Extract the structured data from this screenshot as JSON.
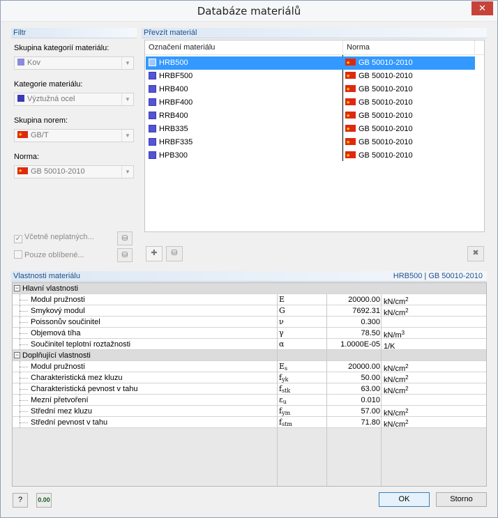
{
  "window": {
    "title": "Databáze materiálů",
    "close_glyph": "✕"
  },
  "filter": {
    "header": "Filtr",
    "group_label": "Skupina kategorií materiálu:",
    "group_value": "Kov",
    "category_label": "Kategorie materiálu:",
    "category_value": "Výztužná ocel",
    "norm_group_label": "Skupina norem:",
    "norm_group_value": "GB/T",
    "norm_label": "Norma:",
    "norm_value": "GB 50010-2010",
    "include_invalid": "Včetně neplatných...",
    "favorites_only": "Pouze oblíbené..."
  },
  "materials": {
    "header": "Převzít materiál",
    "col_name": "Označení materiálu",
    "col_norm": "Norma",
    "rows": [
      {
        "name": "HRB500",
        "norm": "GB 50010-2010"
      },
      {
        "name": "HRBF500",
        "norm": "GB 50010-2010"
      },
      {
        "name": "HRB400",
        "norm": "GB 50010-2010"
      },
      {
        "name": "HRBF400",
        "norm": "GB 50010-2010"
      },
      {
        "name": "RRB400",
        "norm": "GB 50010-2010"
      },
      {
        "name": "HRB335",
        "norm": "GB 50010-2010"
      },
      {
        "name": "HRBF335",
        "norm": "GB 50010-2010"
      },
      {
        "name": "HPB300",
        "norm": "GB 50010-2010"
      }
    ]
  },
  "properties": {
    "header": "Vlastnosti materiálu",
    "selected": "HRB500  |  GB 50010-2010",
    "main_group": "Hlavní vlastnosti",
    "main": [
      {
        "name": "Modul pružnosti",
        "sym": "E",
        "sub": "",
        "value": "20000.00",
        "unit": "kN/cm",
        "pow": "2"
      },
      {
        "name": "Smykový modul",
        "sym": "G",
        "sub": "",
        "value": "7692.31",
        "unit": "kN/cm",
        "pow": "2"
      },
      {
        "name": "Poissonův součinitel",
        "sym": "ν",
        "sub": "",
        "value": "0.300",
        "unit": "",
        "pow": ""
      },
      {
        "name": "Objemová tíha",
        "sym": "γ",
        "sub": "",
        "value": "78.50",
        "unit": "kN/m",
        "pow": "3"
      },
      {
        "name": "Součinitel teplotní roztažnosti",
        "sym": "α",
        "sub": "",
        "value": "1.0000E-05",
        "unit": "1/K",
        "pow": ""
      }
    ],
    "extra_group": "Doplňující vlastnosti",
    "extra": [
      {
        "name": "Modul pružnosti",
        "sym": "E",
        "sub": "s",
        "value": "20000.00",
        "unit": "kN/cm",
        "pow": "2"
      },
      {
        "name": "Charakteristická mez kluzu",
        "sym": "f",
        "sub": "yk",
        "value": "50.00",
        "unit": "kN/cm",
        "pow": "2"
      },
      {
        "name": "Charakteristická pevnost v tahu",
        "sym": "f",
        "sub": "stk",
        "value": "63.00",
        "unit": "kN/cm",
        "pow": "2"
      },
      {
        "name": "Mezní přetvoření",
        "sym": "ε",
        "sub": "u",
        "value": "0.010",
        "unit": "",
        "pow": ""
      },
      {
        "name": "Střední mez kluzu",
        "sym": "f",
        "sub": "ym",
        "value": "57.00",
        "unit": "kN/cm",
        "pow": "2"
      },
      {
        "name": "Střední pevnost v tahu",
        "sym": "f",
        "sub": "stm",
        "value": "71.80",
        "unit": "kN/cm",
        "pow": "2"
      }
    ]
  },
  "footer": {
    "units_icon_text": "0.00",
    "ok": "OK",
    "cancel": "Storno"
  },
  "colors": {
    "selection": "#3399ff",
    "material_swatch": "#5454d4",
    "header_text": "#1f4f8a",
    "flag": "#de2910"
  }
}
